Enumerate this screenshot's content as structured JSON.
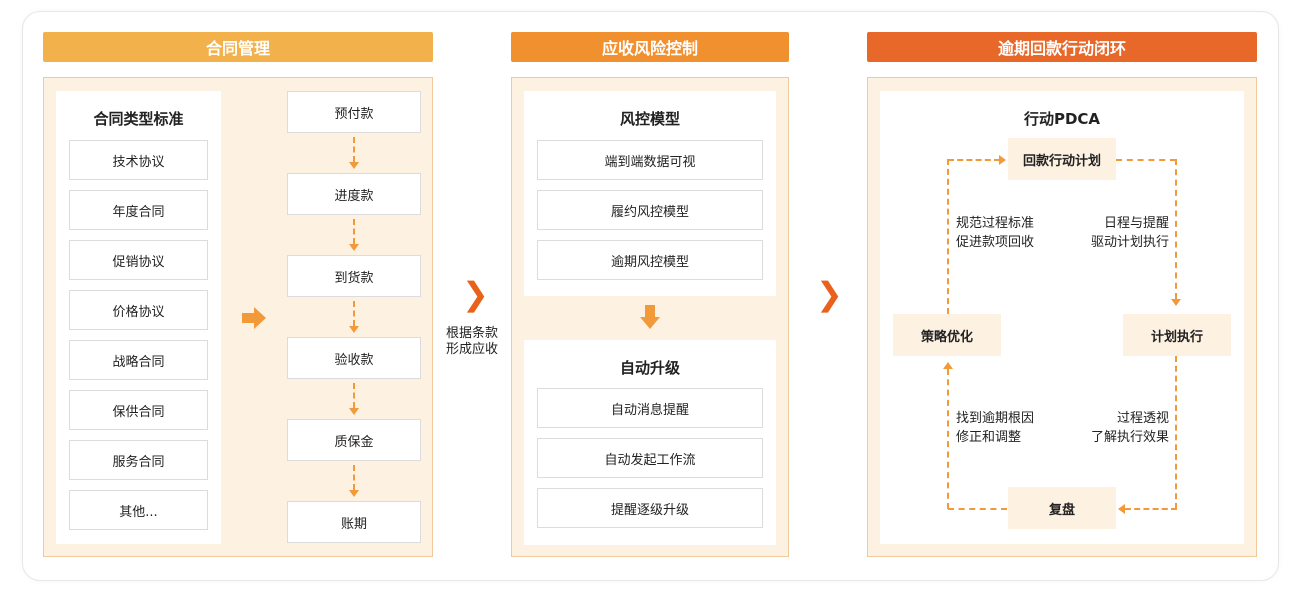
{
  "sections": {
    "contract": {
      "header": "合同管理",
      "types_title": "合同类型标准",
      "types": [
        "技术协议",
        "年度合同",
        "促销协议",
        "价格协议",
        "战略合同",
        "保供合同",
        "服务合同",
        "其他..."
      ],
      "payments": [
        "预付款",
        "进度款",
        "到货款",
        "验收款",
        "质保金",
        "账期"
      ]
    },
    "risk": {
      "header": "应收风险控制",
      "model_title": "风控模型",
      "models": [
        "端到端数据可视",
        "履约风控模型",
        "逾期风控模型"
      ],
      "upgrade_title": "自动升级",
      "upgrades": [
        "自动消息提醒",
        "自动发起工作流",
        "提醒逐级升级"
      ]
    },
    "overdue": {
      "header": "逾期回款行动闭环",
      "pdca_title": "行动PDCA",
      "plan": "回款行动计划",
      "do": "计划执行",
      "check": "复盘",
      "act": "策略优化",
      "note_top_left": [
        "规范过程标准",
        "促进款项回收"
      ],
      "note_top_right": [
        "日程与提醒",
        "驱动计划执行"
      ],
      "note_bottom_left": [
        "找到逾期根因",
        "修正和调整"
      ],
      "note_bottom_right": [
        "过程透视",
        "了解执行效果"
      ]
    }
  },
  "connector_label": [
    "根据条款",
    "形成应收"
  ],
  "colors": {
    "banner1": "#f3b14b",
    "banner2": "#f0902f",
    "banner3": "#e8682a",
    "accent": "#f29a3a",
    "chevron": "#e8621c"
  }
}
